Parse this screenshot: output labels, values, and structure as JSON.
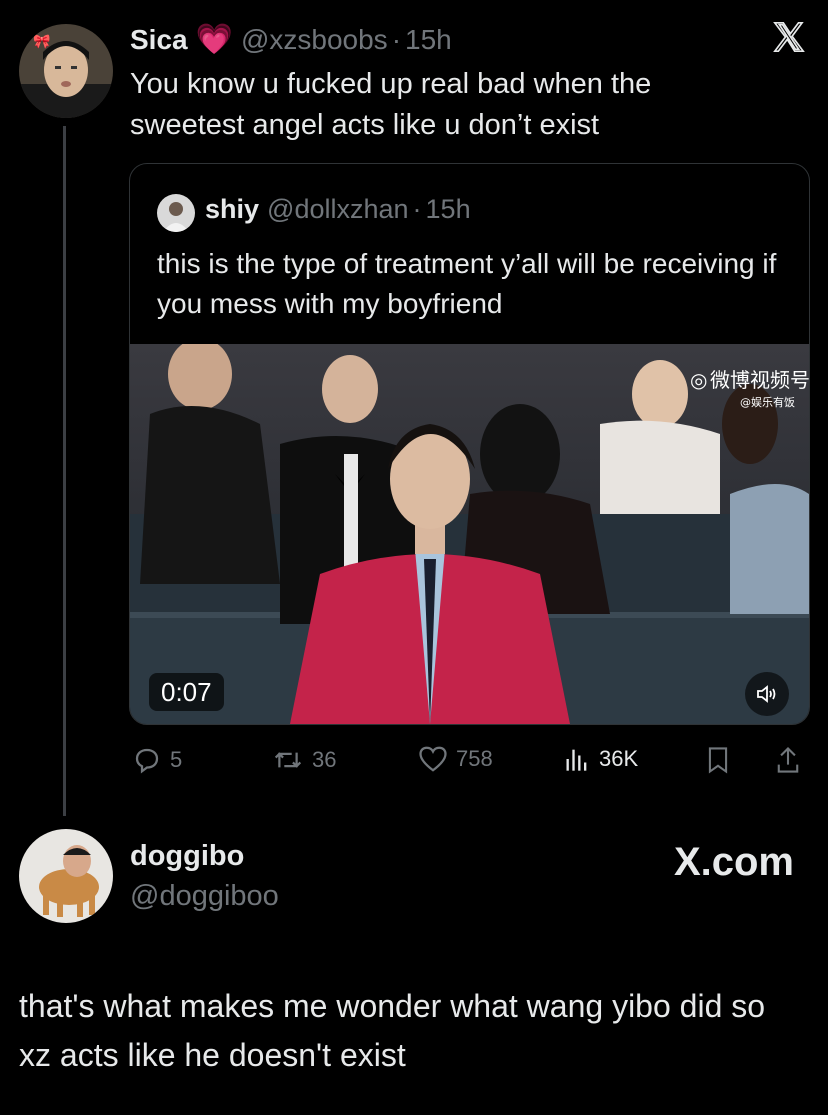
{
  "tweet": {
    "author_name": "Sica",
    "emoji": "💗",
    "handle": "@xzsboobs",
    "dot": "·",
    "time": "15h",
    "text": "You know u fucked up real bad when the sweetest angel acts like u don’t exist"
  },
  "quote": {
    "author_name": "shiy",
    "handle": "@dollxzhan",
    "dot": "·",
    "time": "15h",
    "text": "this is the type of treatment y’all will be receiving if you mess with my boyfriend",
    "video": {
      "duration": "0:07",
      "watermark": "微博视频号",
      "watermark_sub": "@娱乐有饭"
    }
  },
  "actions": {
    "replies": "5",
    "reposts": "36",
    "likes": "758",
    "views": "36K"
  },
  "reply": {
    "author_name": "doggibo",
    "handle": "@doggiboo",
    "brand": "X.com",
    "text": "that's what makes me wonder what wang yibo did so xz acts like he doesn't exist"
  },
  "icons": {
    "close": "x-logo-icon",
    "reply": "comment-icon",
    "repost": "repost-icon",
    "like": "heart-icon",
    "views": "views-icon",
    "bookmark": "bookmark-icon",
    "share": "share-icon",
    "sound": "speaker-icon"
  },
  "colors": {
    "background": "#000000",
    "text": "#e7e9ea",
    "muted": "#71767b",
    "suit": "#c4234a"
  }
}
